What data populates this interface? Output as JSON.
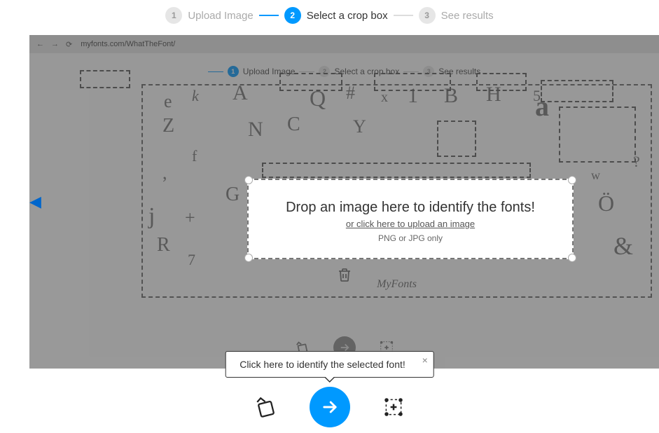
{
  "stepper": {
    "steps": [
      {
        "num": "1",
        "label": "Upload Image"
      },
      {
        "num": "2",
        "label": "Select a crop box"
      },
      {
        "num": "3",
        "label": "See results"
      }
    ],
    "active_index": 1
  },
  "background": {
    "url": "myfonts.com/WhatTheFont/",
    "inner_stepper": {
      "steps": [
        {
          "num": "1",
          "label": "Upload Image"
        },
        {
          "num": "2",
          "label": "Select a crop box"
        },
        {
          "num": "3",
          "label": "See results"
        }
      ],
      "active_index": 0
    },
    "drop": {
      "title": "Drop an image here to identify the fonts!",
      "sub": "or click here to upload an image",
      "note": "PNG or JPG only"
    },
    "logo": "MyFonts"
  },
  "tooltip": {
    "text": "Click here to identify the selected font!",
    "close": "×"
  },
  "crop": {
    "title": "Drop an image here to identify the fonts!",
    "sub": "or click here to upload an image",
    "note": "PNG or JPG only"
  },
  "icons": {
    "arrow_left": "←",
    "arrow_right": "→",
    "reload": "⟳"
  }
}
